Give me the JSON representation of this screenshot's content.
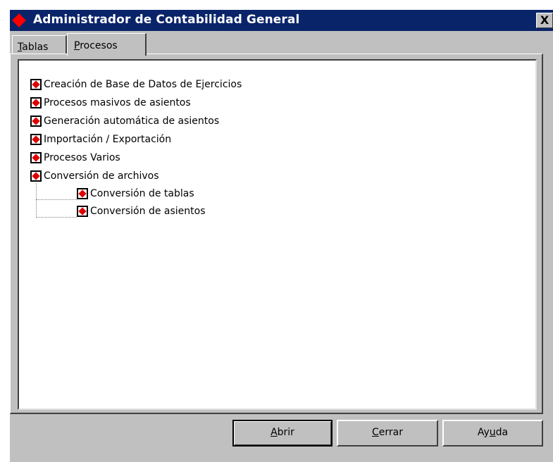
{
  "window": {
    "title": "Administrador de Contabilidad General",
    "close_glyph": "X"
  },
  "tabs": [
    {
      "accel": "T",
      "rest": "ablas",
      "label": "Tablas",
      "active": false
    },
    {
      "accel": "P",
      "rest": "rocesos",
      "label": "Procesos",
      "active": true
    }
  ],
  "tree": {
    "items": [
      {
        "label": "Creación de Base de Datos de Ejercicios",
        "level": 0
      },
      {
        "label": "Procesos masivos de asientos",
        "level": 0
      },
      {
        "label": "Generación automática de asientos",
        "level": 0
      },
      {
        "label": "Importación / Exportación",
        "level": 0
      },
      {
        "label": "Procesos Varios",
        "level": 0
      },
      {
        "label": "Conversión de archivos",
        "level": 0
      },
      {
        "label": "Conversión de tablas",
        "level": 1
      },
      {
        "label": "Conversión de asientos",
        "level": 1
      }
    ],
    "icon": "diamond-node-icon",
    "accent_color": "#e00000"
  },
  "buttons": {
    "abrir": {
      "accel": "A",
      "rest": "brir",
      "label": "Abrir"
    },
    "cerrar": {
      "accel": "C",
      "rest": "errar",
      "label": "Cerrar"
    },
    "ayuda": {
      "pre": "Ay",
      "accel": "u",
      "rest": "da",
      "label": "Ayuda"
    }
  },
  "colors": {
    "titlebar": "#0a246a",
    "face": "#c0c0c0",
    "title_icon": "#ff0000"
  }
}
